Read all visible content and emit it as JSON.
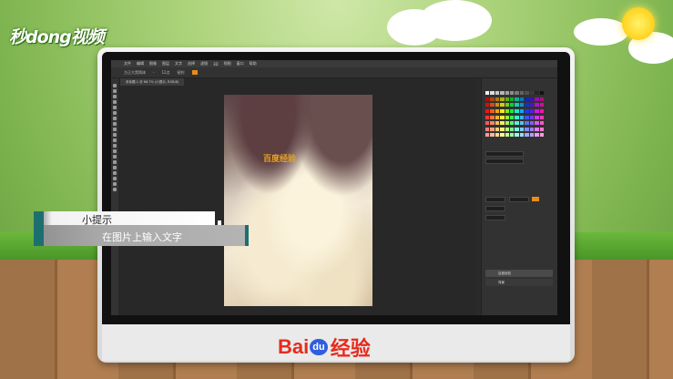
{
  "brand": {
    "corner_logo": "秒dong视频",
    "bottom_logo_bai": "Bai",
    "bottom_logo_du": "du",
    "bottom_logo_suffix": "经验"
  },
  "photoshop": {
    "menu": [
      "文件",
      "编辑",
      "图像",
      "图层",
      "文字",
      "选择",
      "滤镜",
      "3D",
      "视图",
      "窗口",
      "帮助"
    ],
    "options": [
      "方正大黑简体",
      "-",
      "12点",
      "锐利"
    ],
    "document_tab": "未标题-1 @ 66.7% (小提示, RGB/8)",
    "canvas_text": "百度经验",
    "layers": [
      {
        "name": "百度经验",
        "selected": true
      },
      {
        "name": "背景",
        "selected": false
      }
    ]
  },
  "tip": {
    "title": "小提示",
    "body": "在图片上输入文字"
  },
  "colors": {
    "tip_accent": "#1d6f6f",
    "baidu_red": "#e62b1e",
    "baidu_blue": "#2f5ee0",
    "text_overlay": "#e8a020"
  }
}
